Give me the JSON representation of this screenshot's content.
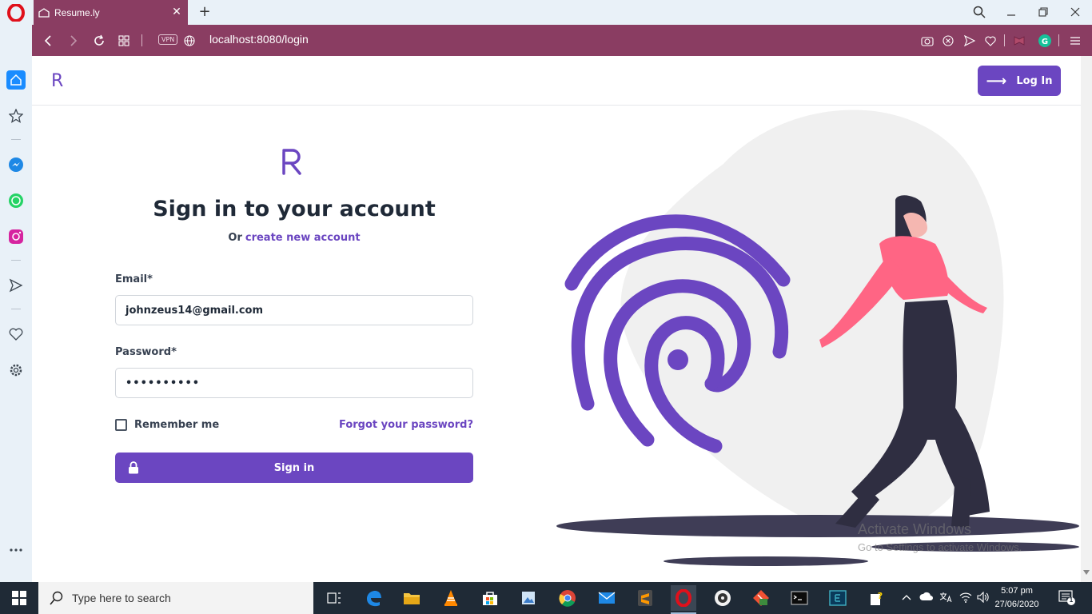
{
  "browser": {
    "tab_title": "Resume.ly",
    "url": "localhost:8080/login",
    "vpn_label": "VPN",
    "accent_color": "#8a3d62"
  },
  "app": {
    "header_logo": "R",
    "login_button": "Log In",
    "brand_color": "#6b46c1"
  },
  "form": {
    "title": "Sign in to your account",
    "subtitle_prefix": "Or",
    "create_account_link": "create new account",
    "email_label": "Email*",
    "email_value": "johnzeus14@gmail.com",
    "password_label": "Password*",
    "password_value": "••••••••••",
    "remember_label": "Remember me",
    "forgot_link": "Forgot your password?",
    "signin_button": "Sign in"
  },
  "watermark": {
    "line1": "Activate Windows",
    "line2": "Go to Settings to activate Windows."
  },
  "taskbar": {
    "search_placeholder": "Type here to search",
    "time": "5:07 pm",
    "date": "27/06/2020",
    "notification_count": "1"
  }
}
